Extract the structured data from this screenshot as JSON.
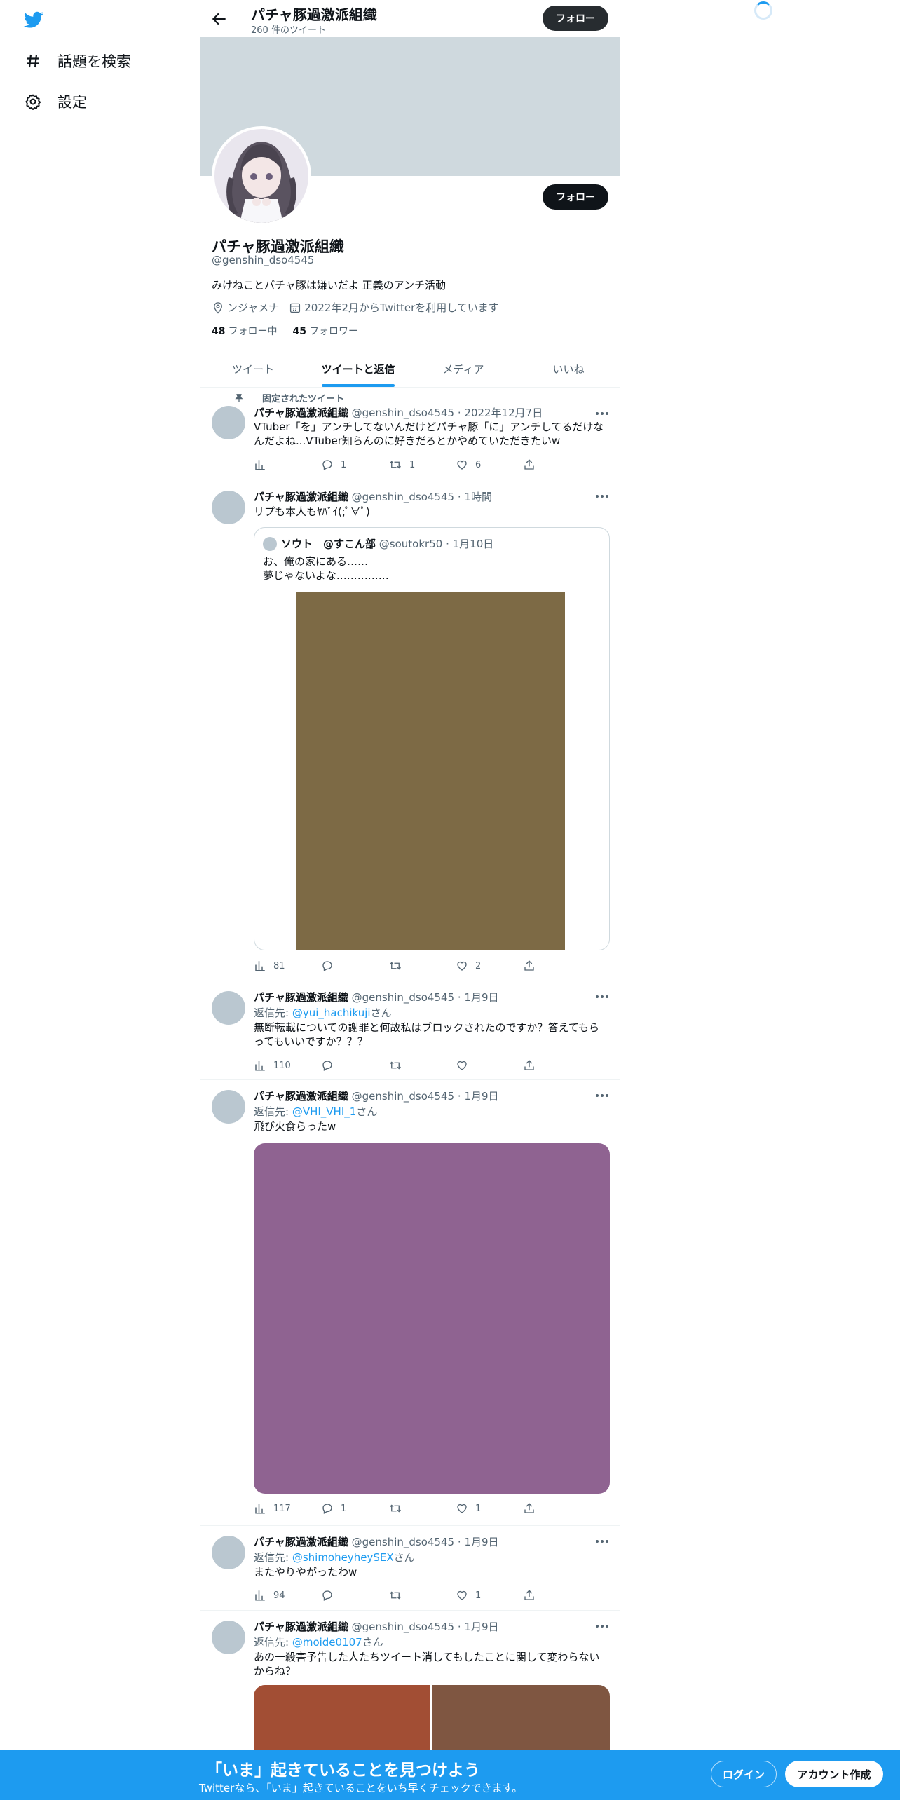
{
  "nav": {
    "explore_label": "話題を検索",
    "settings_label": "設定"
  },
  "header": {
    "name": "パチャ豚過激派組織",
    "tweet_count": "260 件のツイート",
    "follow_label": "フォロー"
  },
  "profile": {
    "name": "パチャ豚過激派組織",
    "handle": "@genshin_dso4545",
    "bio": "みけねことパチャ豚は嫌いだよ 正義のアンチ活動",
    "location": "ンジャメナ",
    "joined": "2022年2月からTwitterを利用しています",
    "following_count": "48",
    "following_label": "フォロー中",
    "followers_count": "45",
    "followers_label": "フォロワー",
    "follow_label": "フォロー"
  },
  "tabs": [
    "ツイート",
    "ツイートと返信",
    "メディア",
    "いいね"
  ],
  "active_tab": 1,
  "tweets": [
    {
      "pinned_label": "固定されたツイート",
      "name": "パチャ豚過激派組織",
      "handle": "@genshin_dso4545",
      "date": "2022年12月7日",
      "text_line1": "VTuber「を」アンチしてないんだけどパチャ豚「に」アンチしてるだけな",
      "text_line2": "んだよね...VTuber知らんのに好きだろとかやめていただきたいw",
      "views": "",
      "replies": "1",
      "retweets": "1",
      "likes": "6"
    },
    {
      "name": "パチャ豚過激派組織",
      "handle": "@genshin_dso4545",
      "date": "1時間",
      "text": "リプも本人もﾔﾊﾞｲ(;ﾟ∀ﾟ)",
      "quote": {
        "name": "ソウト　@すこん部",
        "handle": "@soutokr50",
        "date": "1月10日",
        "line1": "お、俺の家にある……",
        "line2": "夢じゃないよな……………"
      },
      "views": "81",
      "replies": "",
      "retweets": "",
      "likes": "2"
    },
    {
      "name": "パチャ豚過激派組織",
      "handle": "@genshin_dso4545",
      "date": "1月9日",
      "reply_prefix": "返信先: ",
      "reply_to": "@yui_hachikuji",
      "reply_suffix": "さん",
      "text_line1": "無断転載についての謝罪と何故私はブロックされたのですか？答えてもら",
      "text_line2": "ってもいいですか？？？",
      "views": "110",
      "replies": "",
      "retweets": "",
      "likes": ""
    },
    {
      "name": "パチャ豚過激派組織",
      "handle": "@genshin_dso4545",
      "date": "1月9日",
      "reply_prefix": "返信先: ",
      "reply_to": "@VHI_VHI_1",
      "reply_suffix": "さん",
      "text": "飛び火食らったw",
      "views": "117",
      "replies": "1",
      "retweets": "",
      "likes": "1"
    },
    {
      "name": "パチャ豚過激派組織",
      "handle": "@genshin_dso4545",
      "date": "1月9日",
      "reply_prefix": "返信先: ",
      "reply_to": "@shimoheyheySEX",
      "reply_suffix": "さん",
      "text": "またやりやがったわw",
      "views": "94",
      "replies": "",
      "retweets": "",
      "likes": "1"
    },
    {
      "name": "パチャ豚過激派組織",
      "handle": "@genshin_dso4545",
      "date": "1月9日",
      "reply_prefix": "返信先: ",
      "reply_to": "@moide0107",
      "reply_suffix": "さん",
      "text_line1": "あの一殺害予告した人たちツイート消してもしたことに関して変わらない",
      "text_line2": "からね？"
    }
  ],
  "bottom": {
    "title": "「いま」起きていることを見つけよう",
    "subtitle": "Twitterなら、「いま」起きていることをいち早くチェックできます。",
    "login_label": "ログイン",
    "signup_label": "アカウント作成"
  },
  "colors": {
    "accent": "#1d9bf0",
    "banner": "#cfd9de",
    "media_brown": "#7d6a45",
    "media_purple": "#8f6391",
    "media_red": "#a24e34",
    "media_brown2": "#7f5641"
  },
  "icons": [
    "twitter-bird-icon",
    "hashtag-icon",
    "gear-icon",
    "back-arrow-icon",
    "pin-icon",
    "location-icon",
    "calendar-icon",
    "views-icon",
    "reply-icon",
    "retweet-icon",
    "like-icon",
    "share-icon",
    "more-icon"
  ]
}
